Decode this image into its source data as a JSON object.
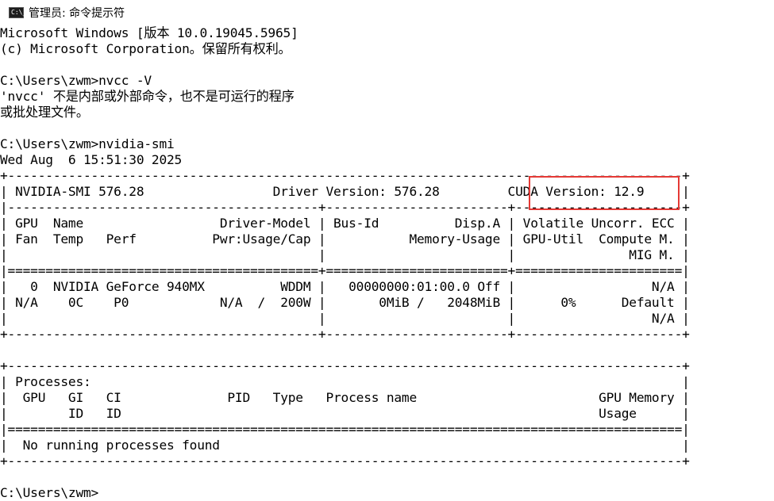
{
  "window": {
    "title": "管理员: 命令提示符",
    "icon": "cmd-icon",
    "icon_text": "C:\\_"
  },
  "console": {
    "lines": [
      "Microsoft Windows [版本 10.0.19045.5965]",
      "(c) Microsoft Corporation。保留所有权利。",
      "",
      "C:\\Users\\zwm>nvcc -V",
      "'nvcc' 不是内部或外部命令，也不是可运行的程序",
      "或批处理文件。",
      "",
      "C:\\Users\\zwm>nvidia-smi",
      "Wed Aug  6 15:51:30 2025",
      "+-----------------------------------------------------------------------------------------+",
      "| NVIDIA-SMI 576.28                 Driver Version: 576.28         CUDA Version: 12.9     |",
      "|-----------------------------------------+------------------------+----------------------+",
      "| GPU  Name                  Driver-Model | Bus-Id          Disp.A | Volatile Uncorr. ECC |",
      "| Fan  Temp   Perf          Pwr:Usage/Cap |           Memory-Usage | GPU-Util  Compute M. |",
      "|                                         |                        |               MIG M. |",
      "|=========================================+========================+======================|",
      "|   0  NVIDIA GeForce 940MX          WDDM |   00000000:01:00.0 Off |                  N/A |",
      "| N/A    0C    P0            N/A  /  200W |       0MiB /   2048MiB |      0%      Default |",
      "|                                         |                        |                  N/A |",
      "+-----------------------------------------+------------------------+----------------------+",
      "",
      "+-----------------------------------------------------------------------------------------+",
      "| Processes:                                                                              |",
      "|  GPU   GI   CI              PID   Type   Process name                        GPU Memory |",
      "|        ID   ID                                                               Usage      |",
      "|=========================================================================================|",
      "|  No running processes found                                                             |",
      "+-----------------------------------------------------------------------------------------+",
      "",
      "C:\\Users\\zwm>"
    ]
  },
  "highlight": {
    "label": "CUDA Version: 12.9",
    "border_color": "#e53935"
  }
}
